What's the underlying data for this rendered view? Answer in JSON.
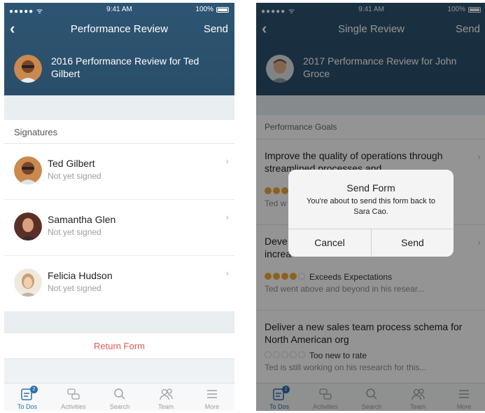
{
  "left": {
    "status": {
      "signal": "●●●●● ᯤ",
      "time": "9:41 AM",
      "battery": "100%"
    },
    "nav": {
      "title": "Performance Review",
      "send": "Send"
    },
    "review_title": "2016 Performance Review for Ted Gilbert",
    "signatures_label": "Signatures",
    "signatures": [
      {
        "name": "Ted Gilbert",
        "status": "Not yet signed"
      },
      {
        "name": "Samantha Glen",
        "status": "Not yet signed"
      },
      {
        "name": "Felicia Hudson",
        "status": "Not yet signed"
      }
    ],
    "return_form": "Return Form"
  },
  "right": {
    "status": {
      "signal": "●●●●● ᯤ",
      "time": "9:41 AM",
      "battery": "100%"
    },
    "nav": {
      "title": "Single Review",
      "send": "Send"
    },
    "review_title": "2017 Performance Review for John Groce",
    "goals_label": "Performance Goals",
    "goals": [
      {
        "title": "Improve the quality of operations through streamlined processes and",
        "rating_text": "",
        "note": "Ted w"
      },
      {
        "title": "Deve increa",
        "rating": 4,
        "rating_text": "Exceeds Expectations",
        "note": "Ted went above and beyond in his resear..."
      },
      {
        "title": "Deliver a new sales team process schema for North American org",
        "rating": 0,
        "rating_text": "Too new to rate",
        "note": "Ted is still working on his research for this..."
      }
    ],
    "dialog": {
      "title": "Send Form",
      "message": "You're about to send this form back to Sara Cao.",
      "cancel": "Cancel",
      "send": "Send"
    }
  },
  "tabs": [
    {
      "label": "To Dos",
      "icon": "todo-icon",
      "badge": "2"
    },
    {
      "label": "Activities",
      "icon": "activities-icon"
    },
    {
      "label": "Search",
      "icon": "search-icon"
    },
    {
      "label": "Team",
      "icon": "team-icon"
    },
    {
      "label": "More",
      "icon": "more-icon"
    }
  ],
  "colors": {
    "header": "#2d5573",
    "accent": "#2e6fae",
    "danger": "#e0585b",
    "star": "#f0a838"
  }
}
